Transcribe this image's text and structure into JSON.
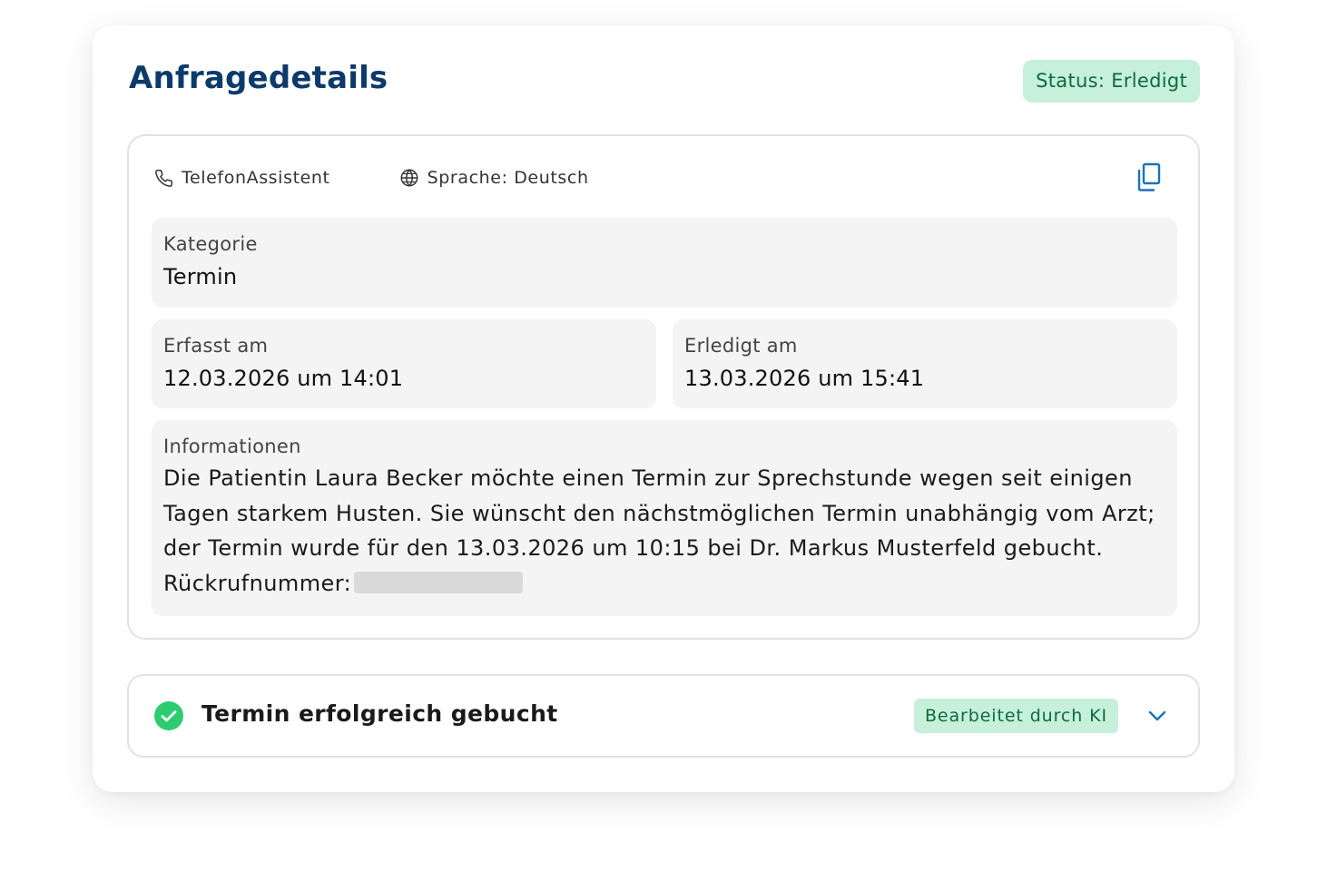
{
  "header": {
    "title": "Anfragedetails",
    "status_badge": "Status: Erledigt"
  },
  "meta": {
    "channel_icon": "phone-icon",
    "channel": "TelefonAssistent",
    "language_icon": "globe-icon",
    "language": "Sprache: Deutsch",
    "copy_icon": "copy-icon"
  },
  "fields": {
    "kategorie": {
      "label": "Kategorie",
      "value": "Termin"
    },
    "erfasst": {
      "label": "Erfasst am",
      "value": "12.03.2026 um 14:01"
    },
    "erledigt": {
      "label": "Erledigt am",
      "value": "13.03.2026 um 15:41"
    },
    "informationen": {
      "label": "Informationen",
      "text": "Die Patientin Laura Becker möchte einen Termin zur Sprechstunde wegen seit einigen Tagen starkem Husten. Sie wünscht den nächstmöglichen Termin unabhängig vom Arzt; der Termin wurde für den 13.03.2026 um 10:15 bei Dr. Markus Musterfeld gebucht.",
      "callback_label": "Rückrufnummer:"
    }
  },
  "result": {
    "icon": "check-circle-icon",
    "title": "Termin erfolgreich gebucht",
    "badge": "Bearbeitet durch KI",
    "expand_icon": "chevron-down-icon"
  },
  "colors": {
    "title": "#0b3a6b",
    "badge_bg": "#c6f0da",
    "badge_text": "#0f6a3f",
    "accent_blue": "#1a73b8",
    "success_green": "#2ecc71"
  }
}
